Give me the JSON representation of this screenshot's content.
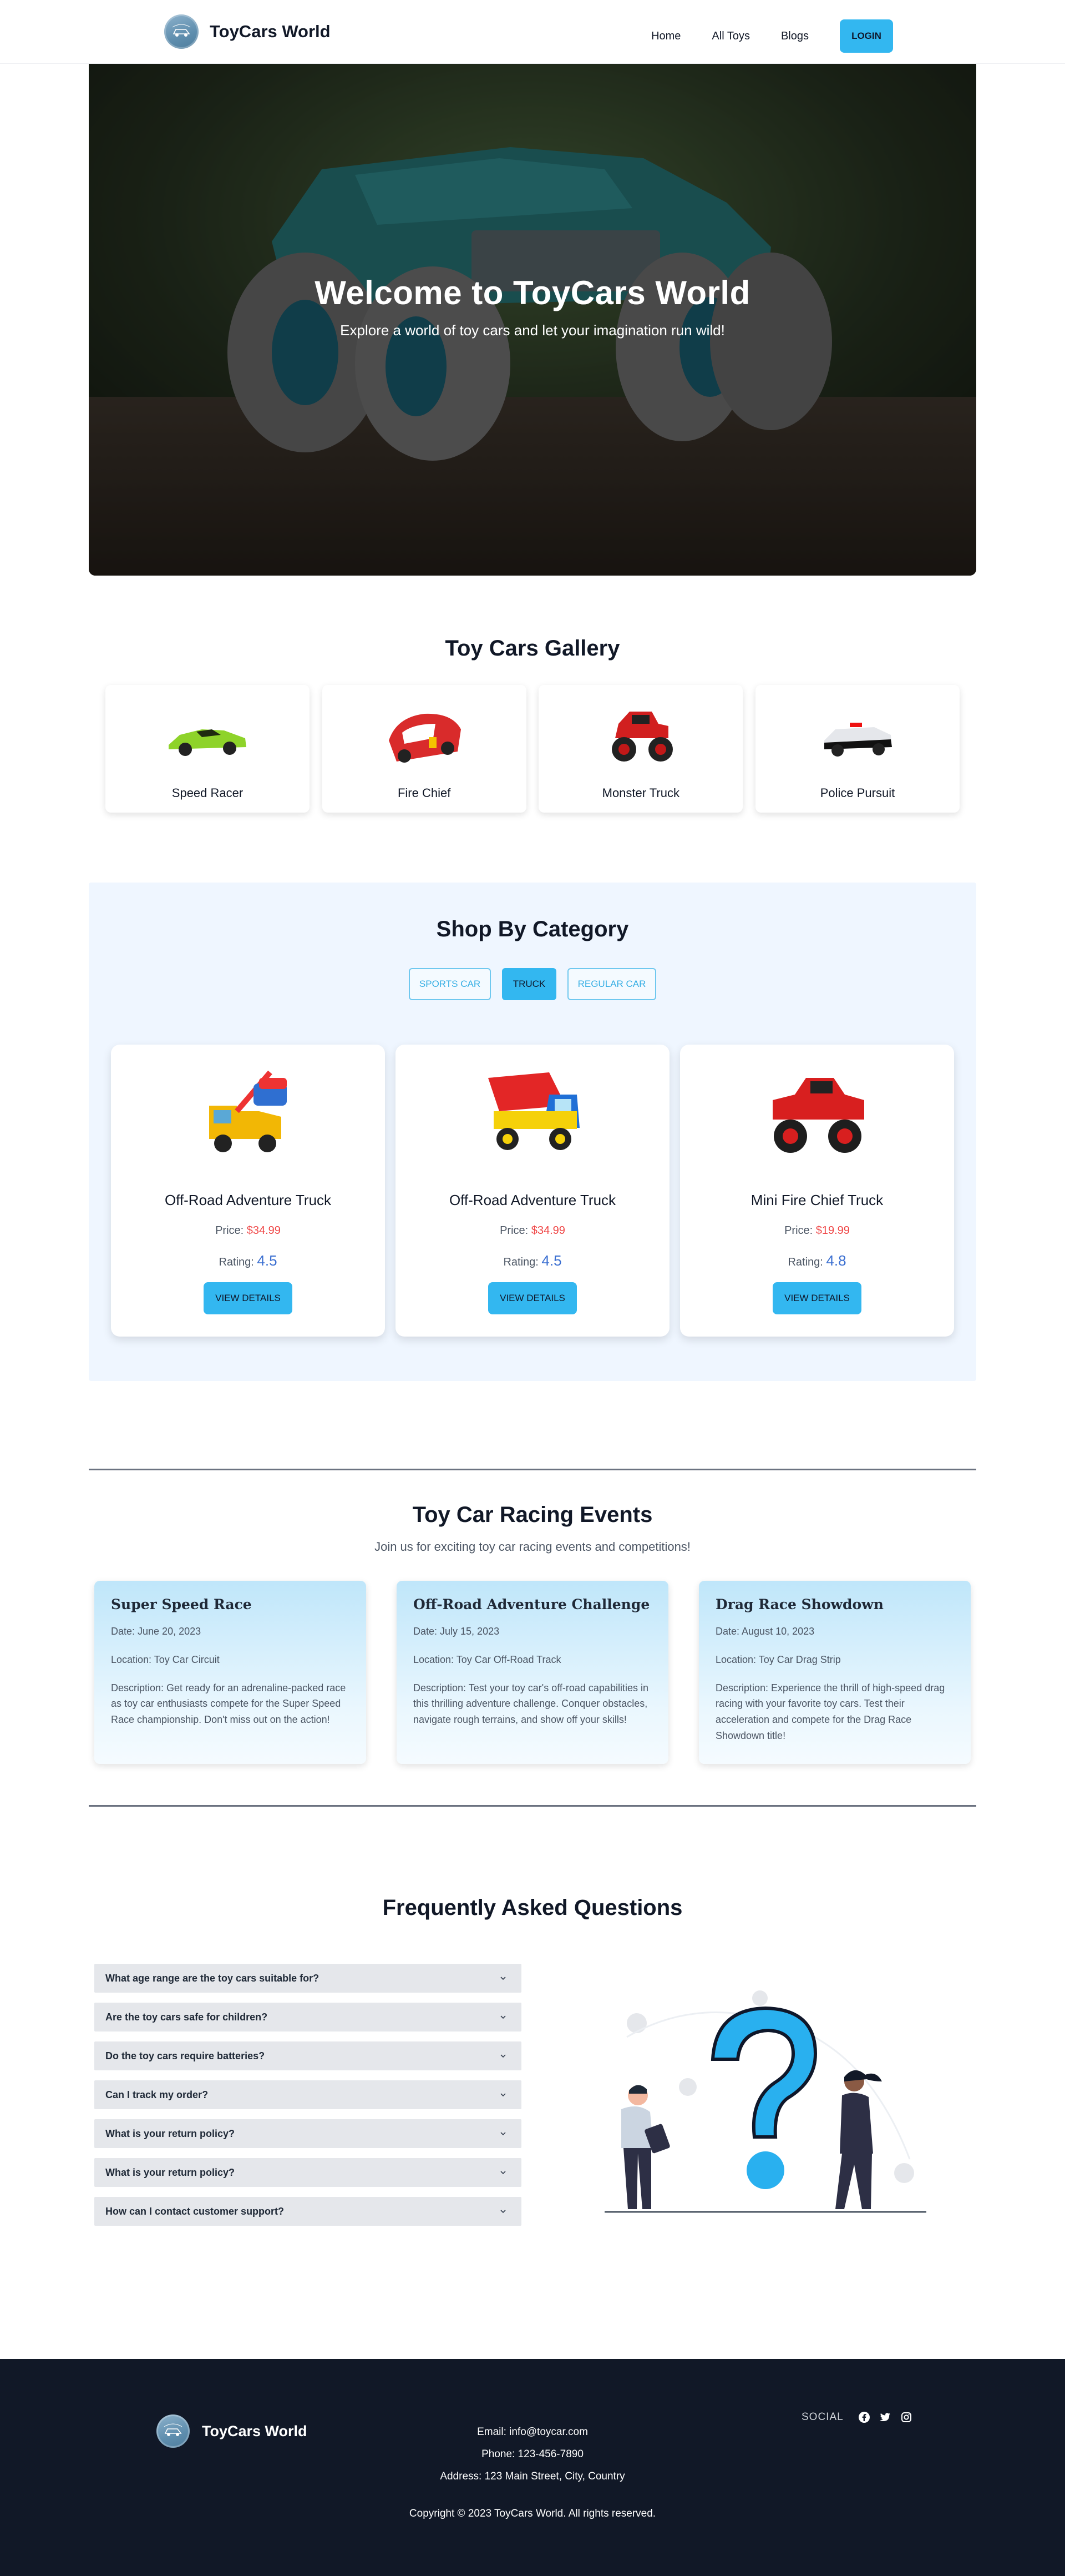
{
  "nav": {
    "brand": "ToyCars World",
    "links": [
      "Home",
      "All Toys",
      "Blogs"
    ],
    "login": "LOGIN"
  },
  "hero": {
    "title": "Welcome to ToyCars World",
    "subtitle": "Explore a world of toy cars and let your imagination run wild!"
  },
  "gallery": {
    "title": "Toy Cars Gallery",
    "items": [
      "Speed Racer",
      "Fire Chief",
      "Monster Truck",
      "Police Pursuit"
    ]
  },
  "category": {
    "title": "Shop By Category",
    "tabs": [
      "SPORTS CAR",
      "TRUCK",
      "REGULAR CAR"
    ],
    "active_tab": "TRUCK",
    "price_label": "Price:",
    "rating_label": "Rating:",
    "button": "VIEW DETAILS",
    "products": [
      {
        "name": "Off-Road Adventure Truck",
        "price": "$34.99",
        "rating": "4.5"
      },
      {
        "name": "Off-Road Adventure Truck",
        "price": "$34.99",
        "rating": "4.5"
      },
      {
        "name": "Mini Fire Chief Truck",
        "price": "$19.99",
        "rating": "4.8"
      }
    ]
  },
  "events": {
    "title": "Toy Car Racing Events",
    "subtitle": "Join us for exciting toy car racing events and competitions!",
    "items": [
      {
        "title": "Super Speed Race",
        "date": "Date: June 20, 2023",
        "location": "Location: Toy Car Circuit",
        "description": "Description: Get ready for an adrenaline-packed race as toy car enthusiasts compete for the Super Speed Race championship. Don't miss out on the action!"
      },
      {
        "title": "Off-Road Adventure Challenge",
        "date": "Date: July 15, 2023",
        "location": "Location: Toy Car Off-Road Track",
        "description": "Description: Test your toy car's off-road capabilities in this thrilling adventure challenge. Conquer obstacles, navigate rough terrains, and show off your skills!"
      },
      {
        "title": "Drag Race Showdown",
        "date": "Date: August 10, 2023",
        "location": "Location: Toy Car Drag Strip",
        "description": "Description: Experience the thrill of high-speed drag racing with your favorite toy cars. Test their acceleration and compete for the Drag Race Showdown title!"
      }
    ]
  },
  "faq": {
    "title": "Frequently Asked Questions",
    "questions": [
      "What age range are the toy cars suitable for?",
      "Are the toy cars safe for children?",
      "Do the toy cars require batteries?",
      "Can I track my order?",
      "What is your return policy?",
      "What is your return policy?",
      "How can I contact customer support?"
    ]
  },
  "footer": {
    "brand": "ToyCars World",
    "email": "Email: info@toycar.com",
    "phone": "Phone: 123-456-7890",
    "address": "Address: 123 Main Street, City, Country",
    "copyright": "Copyright © 2023 ToyCars World. All rights reserved.",
    "social_label": "SOCIAL",
    "social_icons": [
      "facebook-icon",
      "twitter-icon",
      "instagram-icon"
    ]
  },
  "colors": {
    "accent": "#33b7f0",
    "price": "#ef4444",
    "rating": "#3b6fd1",
    "footer_bg": "#111827",
    "category_bg": "#eff6ff"
  }
}
